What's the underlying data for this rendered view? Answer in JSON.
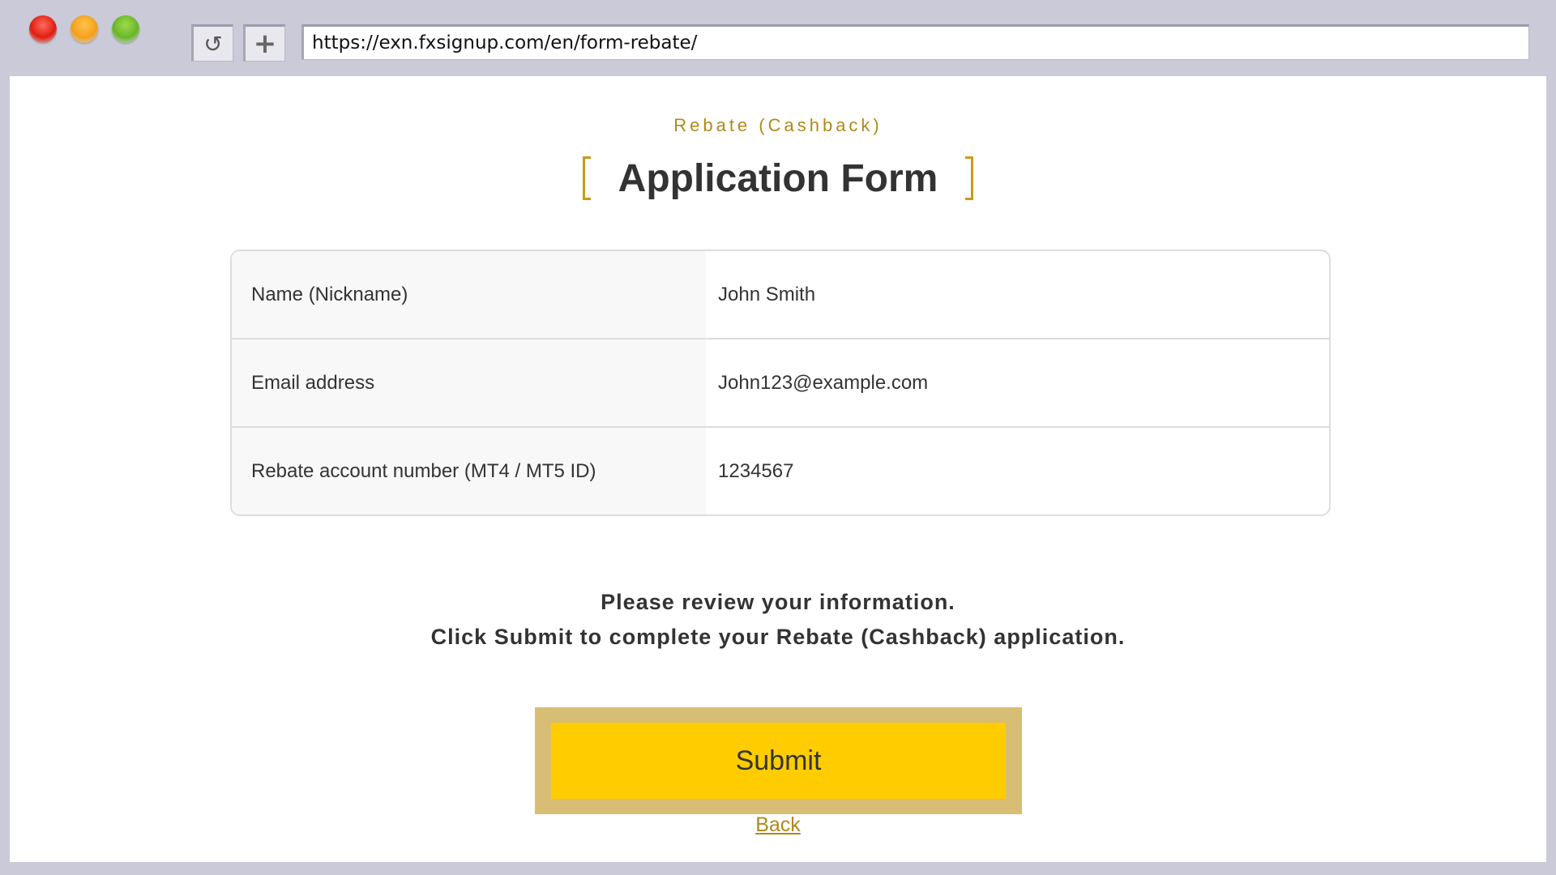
{
  "browser": {
    "url": "https://exn.fxsignup.com/en/form-rebate/",
    "reload_glyph": "↺",
    "newtab_glyph": "+",
    "icons": {
      "close": "close-icon",
      "minimize": "minimize-icon",
      "zoom": "zoom-icon",
      "reload": "reload-icon",
      "new_tab": "plus-icon"
    }
  },
  "page": {
    "subtitle": "Rebate (Cashback)",
    "title": "Application Form",
    "fields": [
      {
        "label": "Name (Nickname)",
        "value": "John Smith"
      },
      {
        "label": "Email address",
        "value": "John123@example.com"
      },
      {
        "label": "Rebate account number (MT4 / MT5 ID)",
        "value": "1234567"
      }
    ],
    "message_line1": "Please review your information.",
    "message_line2": "Click Submit to complete your Rebate (Cashback) application.",
    "submit_label": "Submit",
    "back_label": "Back"
  },
  "colors": {
    "accent": "#b08a18",
    "bracket": "#c99a1e",
    "submit_bg": "#ffcc00",
    "submit_border": "#d7be74",
    "chrome_bg": "#cacad8"
  }
}
